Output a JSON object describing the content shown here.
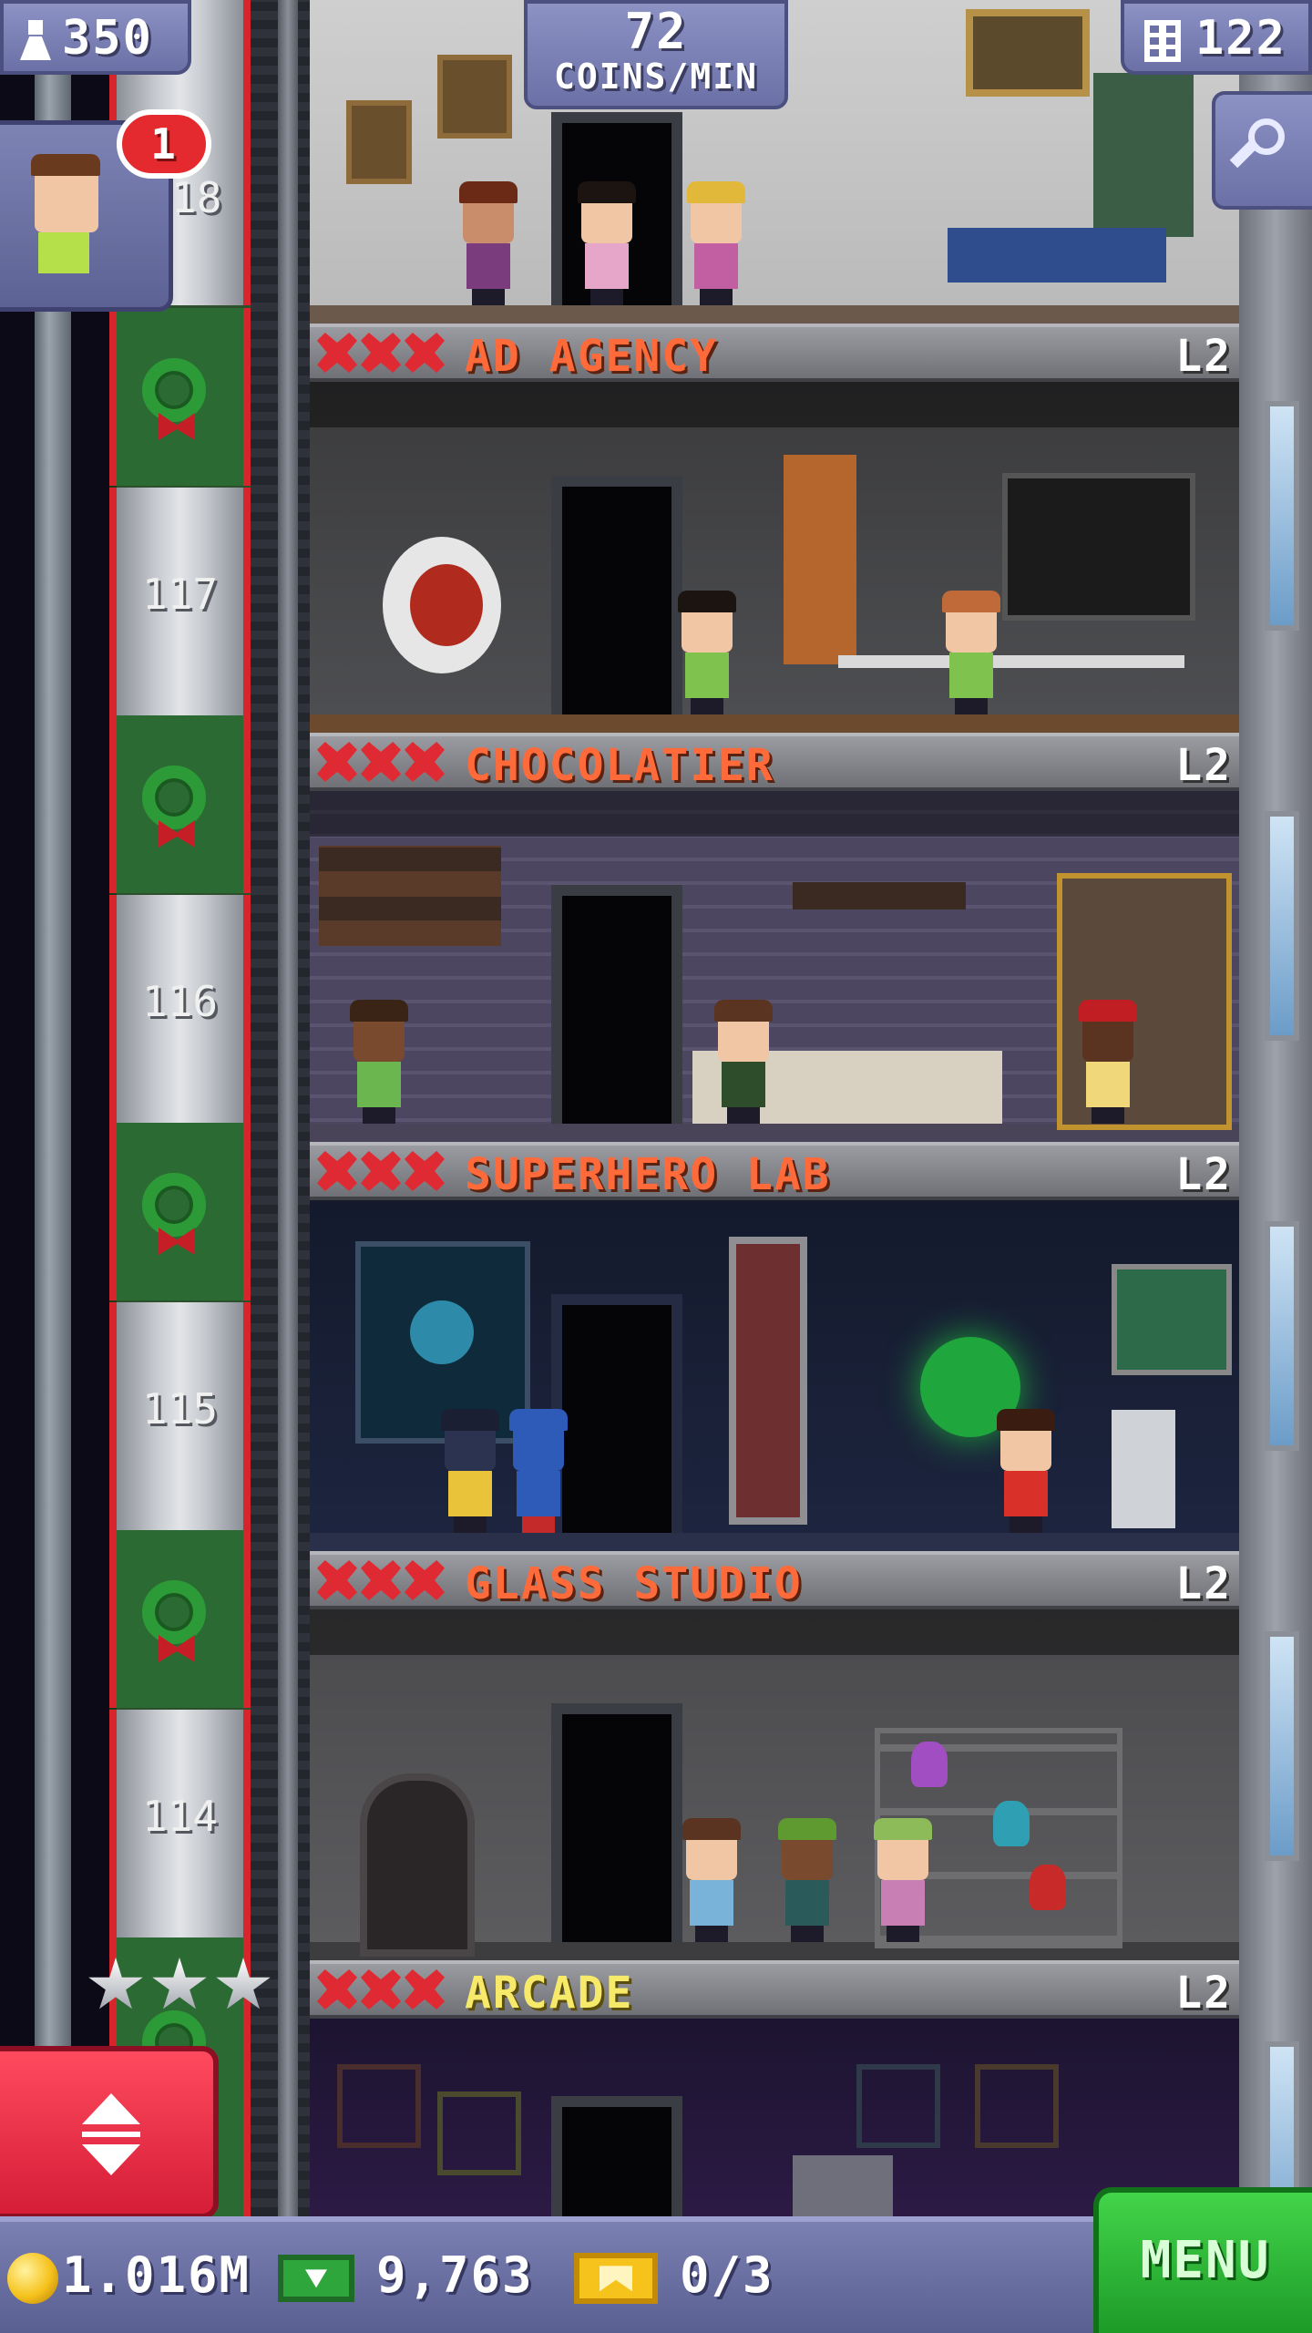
{
  "hud": {
    "population": "350",
    "income_value": "72",
    "income_label": "COINS/MIN",
    "floors": "122",
    "notification_count": "1"
  },
  "elevator": {
    "floor_numbers": [
      "117",
      "116",
      "115",
      "114"
    ],
    "partial_floor_number": "18"
  },
  "rooms": [
    {
      "name": "AD AGENCY",
      "level": "L2"
    },
    {
      "name": "CHOCOLATIER",
      "level": "L2"
    },
    {
      "name": "SUPERHERO LAB",
      "level": "L2"
    },
    {
      "name": "GLASS STUDIO",
      "level": "L2"
    },
    {
      "name": "ARCADE",
      "level": "L2"
    }
  ],
  "bottom_bar": {
    "coins": "1.016M",
    "bux": "9,763",
    "tickets": "0/3",
    "menu_label": "MENU"
  },
  "colors": {
    "hud_purple": "#6b70a6",
    "room_name_orange": "#ff6a3a",
    "arcade_yellow": "#f7e96a",
    "menu_green": "#1d9b28",
    "elevator_red": "#d51d37"
  }
}
